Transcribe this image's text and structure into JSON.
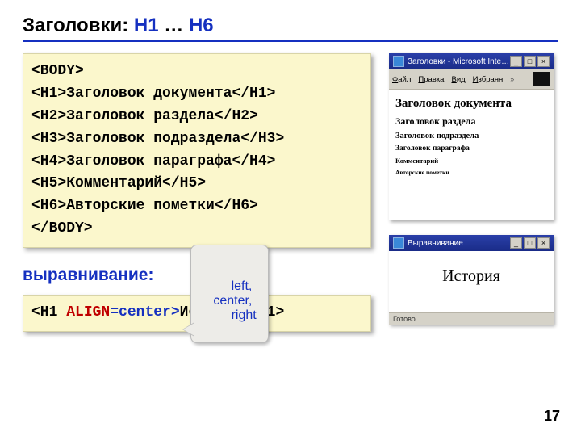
{
  "title": {
    "pre": "Заголовки: ",
    "h1": "H1",
    "mid": " … ",
    "h6": "H6"
  },
  "code": {
    "open_body": "<BODY>",
    "lines": [
      {
        "open": "<H1>",
        "text": "Заголовок документа",
        "close": "</H1>"
      },
      {
        "open": "<H2>",
        "text": "Заголовок раздела",
        "close": "</H2>"
      },
      {
        "open": "<H3>",
        "text": "Заголовок подраздела",
        "close": "</H3>"
      },
      {
        "open": "<H4>",
        "text": "Заголовок параграфа",
        "close": "</H4>"
      },
      {
        "open": "<H5>",
        "text": "Комментарий",
        "close": "</H5>"
      },
      {
        "open": "<H6>",
        "text": "Авторские пометки",
        "close": "</H6>"
      }
    ],
    "close_body": "</BODY>"
  },
  "align": {
    "label": "выравнивание:",
    "callout_l1": "left,",
    "callout_l2": "   center,",
    "callout_l3": "        right",
    "example_open": "<H1 ",
    "example_attr": "ALIGN",
    "example_eq": "=center>",
    "example_text": "История",
    "example_close": "</H1>"
  },
  "preview1": {
    "titlebar": "Заголовки - Microsoft Intern…",
    "menu": {
      "file": "Файл",
      "edit": "Правка",
      "view": "Вид",
      "fav": "Избранн"
    },
    "h1": "Заголовок документа",
    "h2": "Заголовок раздела",
    "h3": "Заголовок подраздела",
    "h4": "Заголовок параграфа",
    "h5": "Комментарий",
    "h6": "Авторские пометки"
  },
  "preview2": {
    "titlebar": "Выравнивание",
    "text": "История",
    "status": "Готово"
  },
  "page_number": "17"
}
